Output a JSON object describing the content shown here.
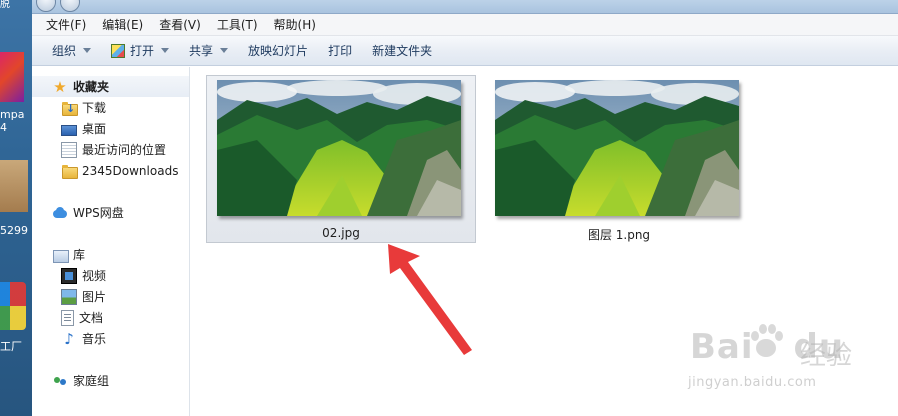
{
  "desktop": {
    "top_fragment": "脱",
    "icon2_text": [
      "mpa",
      "4"
    ],
    "icon3_text": "5299",
    "icon4_text": "工厂"
  },
  "menubar": {
    "items": [
      "文件(F)",
      "编辑(E)",
      "查看(V)",
      "工具(T)",
      "帮助(H)"
    ]
  },
  "toolbar": {
    "organize": "组织",
    "open": "打开",
    "share": "共享",
    "slideshow": "放映幻灯片",
    "print": "打印",
    "new_folder": "新建文件夹"
  },
  "sidebar": {
    "favorites": {
      "label": "收藏夹",
      "items": [
        "下载",
        "桌面",
        "最近访问的位置",
        "2345Downloads"
      ]
    },
    "wps": "WPS网盘",
    "libraries": {
      "label": "库",
      "items": [
        "视频",
        "图片",
        "文档",
        "音乐"
      ]
    },
    "homegroup": "家庭组"
  },
  "files": [
    {
      "name": "02.jpg",
      "selected": true
    },
    {
      "name": "图层 1.png",
      "selected": false
    }
  ],
  "watermark": {
    "brand": "Bai",
    "brand_cn": "经验",
    "url": "jingyan.baidu.com"
  },
  "colors": {
    "annotation_arrow": "#e83a3a",
    "selection_bg": "#e6e9ee",
    "toolbar_text": "#1e3a5f"
  }
}
